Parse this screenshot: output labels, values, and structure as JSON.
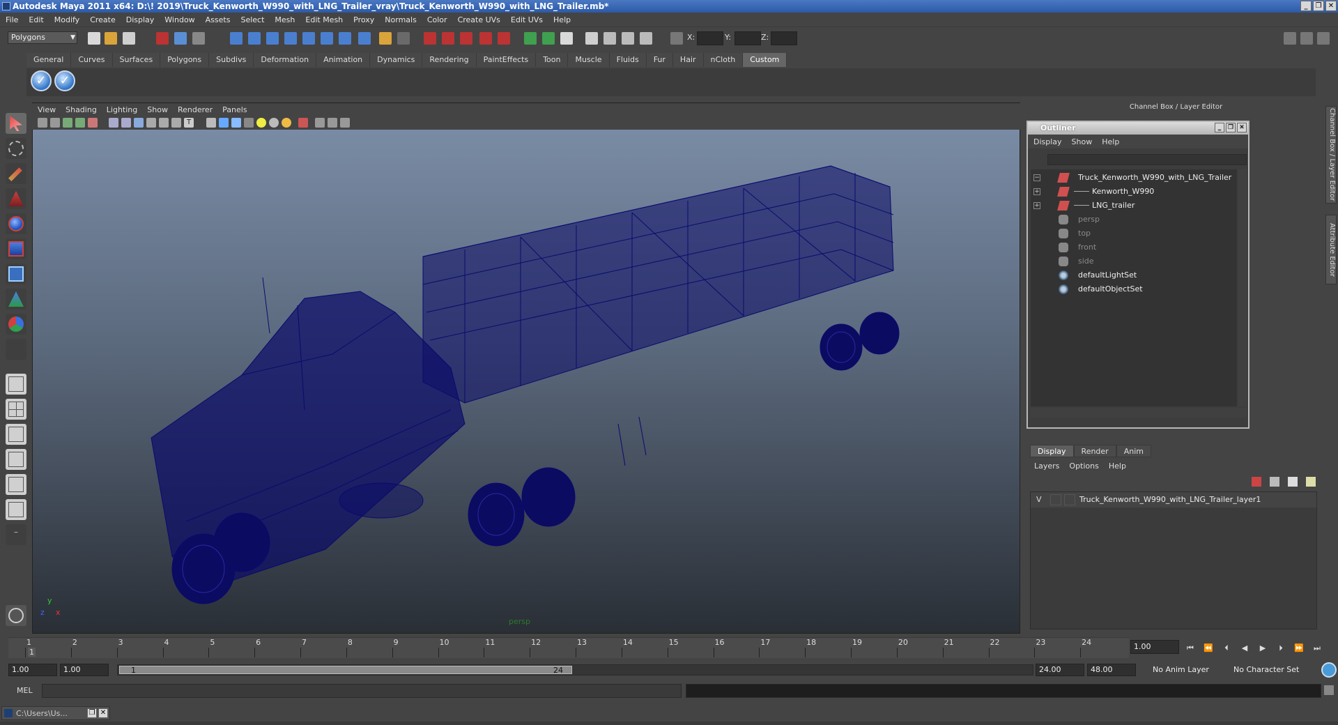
{
  "window": {
    "title": "Autodesk Maya 2011 x64: D:\\! 2019\\Truck_Kenworth_W990_with_LNG_Trailer_vray\\Truck_Kenworth_W990_with_LNG_Trailer.mb*",
    "controls": [
      "_",
      "❐",
      "✕"
    ]
  },
  "menubar": [
    "File",
    "Edit",
    "Modify",
    "Create",
    "Display",
    "Window",
    "Assets",
    "Select",
    "Mesh",
    "Edit Mesh",
    "Proxy",
    "Normals",
    "Color",
    "Create UVs",
    "Edit UVs",
    "Help"
  ],
  "statusline": {
    "mode": "Polygons",
    "x_label": "X:",
    "y_label": "Y:",
    "z_label": "Z:"
  },
  "shelf": {
    "tabs": [
      "General",
      "Curves",
      "Surfaces",
      "Polygons",
      "Subdivs",
      "Deformation",
      "Animation",
      "Dynamics",
      "Rendering",
      "PaintEffects",
      "Toon",
      "Muscle",
      "Fluids",
      "Fur",
      "Hair",
      "nCloth",
      "Custom"
    ],
    "active_tab": "Custom",
    "buttons": [
      "✓",
      "✓"
    ]
  },
  "viewport": {
    "menu": [
      "View",
      "Shading",
      "Lighting",
      "Show",
      "Renderer",
      "Panels"
    ],
    "camera_label": "persp",
    "axis": {
      "x": "x",
      "y": "y",
      "z": "z"
    }
  },
  "right_panel": {
    "header": "Channel Box / Layer Editor",
    "side_tabs": [
      "Channel Box / Layer Editor",
      "Attribute Editor"
    ]
  },
  "outliner": {
    "title": "Outliner",
    "menu": [
      "Display",
      "Show",
      "Help"
    ],
    "items": [
      {
        "label": "Truck_Kenworth_W990_with_LNG_Trailer",
        "expand": "−",
        "icon": "transform-icon",
        "dim": false
      },
      {
        "label": "Kenworth_W990",
        "expand": "+",
        "icon": "transform-icon",
        "dim": false
      },
      {
        "label": "LNG_trailer",
        "expand": "+",
        "icon": "transform-icon",
        "dim": false
      },
      {
        "label": "persp",
        "expand": "",
        "icon": "camera-icon",
        "dim": true
      },
      {
        "label": "top",
        "expand": "",
        "icon": "camera-icon",
        "dim": true
      },
      {
        "label": "front",
        "expand": "",
        "icon": "camera-icon",
        "dim": true
      },
      {
        "label": "side",
        "expand": "",
        "icon": "camera-icon",
        "dim": true
      },
      {
        "label": "defaultLightSet",
        "expand": "",
        "icon": "set-icon",
        "dim": false
      },
      {
        "label": "defaultObjectSet",
        "expand": "",
        "icon": "set-icon",
        "dim": false
      }
    ]
  },
  "layer_editor": {
    "tabs": [
      "Display",
      "Render",
      "Anim"
    ],
    "active_tab": "Display",
    "menu": [
      "Layers",
      "Options",
      "Help"
    ],
    "layers": [
      {
        "visible": "V",
        "name": "Truck_Kenworth_W990_with_LNG_Trailer_layer1"
      }
    ]
  },
  "timeline": {
    "ticks": [
      "1",
      "2",
      "3",
      "4",
      "5",
      "6",
      "7",
      "8",
      "9",
      "10",
      "11",
      "12",
      "13",
      "14",
      "15",
      "16",
      "17",
      "18",
      "19",
      "20",
      "21",
      "22",
      "23",
      "24"
    ],
    "current_frame_marker": "1",
    "current_frame": "1.00",
    "playback_buttons": [
      "⏮",
      "⏪",
      "⏴",
      "◀",
      "▶",
      "⏵",
      "⏩",
      "⏭"
    ]
  },
  "range": {
    "start": "1.00",
    "playback_start": "1.00",
    "slider_start": "1",
    "slider_end": "24",
    "playback_end": "24.00",
    "end": "48.00",
    "anim_layer": "No Anim Layer",
    "character_set": "No Character Set"
  },
  "command_line": {
    "label": "MEL"
  },
  "minimized_window": {
    "label": "C:\\Users\\Us..."
  },
  "colors": {
    "wire": "#0a0a6e",
    "viewport_top": "#7d8fa9",
    "viewport_bottom": "#2a2f36",
    "title_bar": "#2c5aa8"
  }
}
